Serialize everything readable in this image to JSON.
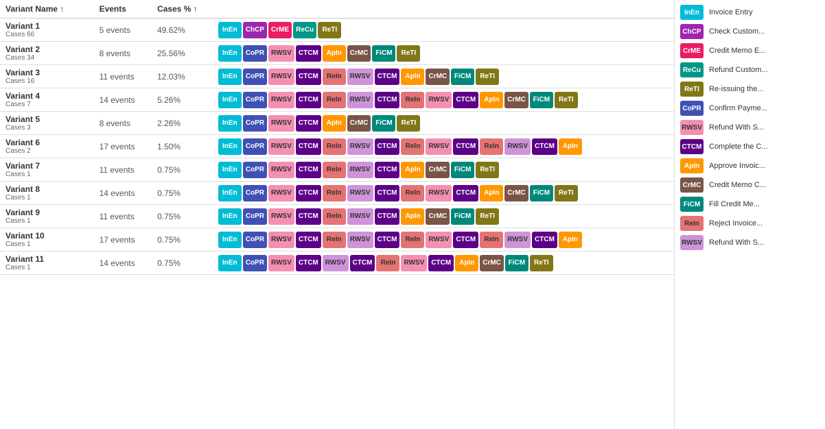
{
  "header": {
    "col1": "Variant Name ↑",
    "col2": "Events",
    "col3": "Cases % ↑"
  },
  "variants": [
    {
      "name": "Variant 1",
      "cases": "Cases 66",
      "events": "5 events",
      "casesPercent": "49.62%",
      "flow": [
        "InEn",
        "ChCP",
        "CrME",
        "ReCu",
        "ReTI"
      ]
    },
    {
      "name": "Variant 2",
      "cases": "Cases 34",
      "events": "8 events",
      "casesPercent": "25.56%",
      "flow": [
        "InEn",
        "CoPR",
        "RWSV",
        "CTCM",
        "ApIn",
        "CrMC",
        "FiCM",
        "ReTI"
      ]
    },
    {
      "name": "Variant 3",
      "cases": "Cases 16",
      "events": "11 events",
      "casesPercent": "12.03%",
      "flow": [
        "InEn",
        "CoPR",
        "RWSV",
        "CTCM",
        "ReIn",
        "RWSV",
        "CTCM",
        "ApIn",
        "CrMC",
        "FiCM",
        "ReTI"
      ]
    },
    {
      "name": "Variant 4",
      "cases": "Cases 7",
      "events": "14 events",
      "casesPercent": "5.26%",
      "flow": [
        "InEn",
        "CoPR",
        "RWSV",
        "CTCM",
        "ReIn",
        "RWSV",
        "CTCM",
        "ReIn",
        "RWSV",
        "CTCM",
        "ApIn",
        "CrMC",
        "FiCM",
        "ReTI"
      ]
    },
    {
      "name": "Variant 5",
      "cases": "Cases 3",
      "events": "8 events",
      "casesPercent": "2.26%",
      "flow": [
        "InEn",
        "CoPR",
        "RWSV",
        "CTCM",
        "ApIn",
        "CrMC",
        "FiCM",
        "ReTI"
      ]
    },
    {
      "name": "Variant 6",
      "cases": "Cases 2",
      "events": "17 events",
      "casesPercent": "1.50%",
      "flow": [
        "InEn",
        "CoPR",
        "RWSV",
        "CTCM",
        "ReIn",
        "RWSV",
        "CTCM",
        "ReIn",
        "RWSV",
        "CTCM",
        "ReIn",
        "RWSV",
        "CTCM",
        "ApIn"
      ]
    },
    {
      "name": "Variant 7",
      "cases": "Cases 1",
      "events": "11 events",
      "casesPercent": "0.75%",
      "flow": [
        "InEn",
        "CoPR",
        "RWSV",
        "CTCM",
        "ReIn",
        "RWSV",
        "CTCM",
        "ApIn",
        "CrMC",
        "FiCM",
        "ReTI"
      ]
    },
    {
      "name": "Variant 8",
      "cases": "Cases 1",
      "events": "14 events",
      "casesPercent": "0.75%",
      "flow": [
        "InEn",
        "CoPR",
        "RWSV",
        "CTCM",
        "ReIn",
        "RWSV",
        "CTCM",
        "ReIn",
        "RWSV",
        "CTCM",
        "ApIn",
        "CrMC",
        "FiCM",
        "ReTI"
      ]
    },
    {
      "name": "Variant 9",
      "cases": "Cases 1",
      "events": "11 events",
      "casesPercent": "0.75%",
      "flow": [
        "InEn",
        "CoPR",
        "RWSV",
        "CTCM",
        "ReIn",
        "RWSV",
        "CTCM",
        "ApIn",
        "CrMC",
        "FiCM",
        "ReTI"
      ]
    },
    {
      "name": "Variant 10",
      "cases": "Cases 1",
      "events": "17 events",
      "casesPercent": "0.75%",
      "flow": [
        "InEn",
        "CoPR",
        "RWSV",
        "CTCM",
        "ReIn",
        "RWSV",
        "CTCM",
        "ReIn",
        "RWSV",
        "CTCM",
        "ReIn",
        "RWSV",
        "CTCM",
        "ApIn"
      ]
    },
    {
      "name": "Variant 11",
      "cases": "Cases 1",
      "events": "14 events",
      "casesPercent": "0.75%",
      "flow": [
        "InEn",
        "CoPR",
        "RWSV",
        "CTCM",
        "RWSV",
        "CTCM",
        "ReIn",
        "RWSV",
        "CTCM",
        "ApIn",
        "CrMC",
        "FiCM",
        "ReTI"
      ]
    }
  ],
  "legend": [
    {
      "code": "InEn",
      "label": "Invoice Entry",
      "colorClass": "c-inen"
    },
    {
      "code": "ChCP",
      "label": "Check Custom...",
      "colorClass": "c-chcp"
    },
    {
      "code": "CrME",
      "label": "Credit Memo E...",
      "colorClass": "c-crme"
    },
    {
      "code": "ReCu",
      "label": "Refund Custom...",
      "colorClass": "c-recu"
    },
    {
      "code": "ReTI",
      "label": "Re-issuing the...",
      "colorClass": "c-reti"
    },
    {
      "code": "CoPR",
      "label": "Confirm Payme...",
      "colorClass": "c-copr"
    },
    {
      "code": "RWSV",
      "label": "Refund With S...",
      "colorClass": "c-rwsv"
    },
    {
      "code": "CTCM",
      "label": "Complete the C...",
      "colorClass": "c-ctcm"
    },
    {
      "code": "ApIn",
      "label": "Approve Invoic...",
      "colorClass": "c-apin"
    },
    {
      "code": "CrMC",
      "label": "Credit Memo C...",
      "colorClass": "c-crmc"
    },
    {
      "code": "FiCM",
      "label": "Fill Credit Me...",
      "colorClass": "c-ficm"
    },
    {
      "code": "ReIn",
      "label": "Reject Invoice...",
      "colorClass": "c-rein"
    },
    {
      "code": "RWSV",
      "label": "Refund With S...",
      "colorClass": "c-rwsv2"
    }
  ]
}
